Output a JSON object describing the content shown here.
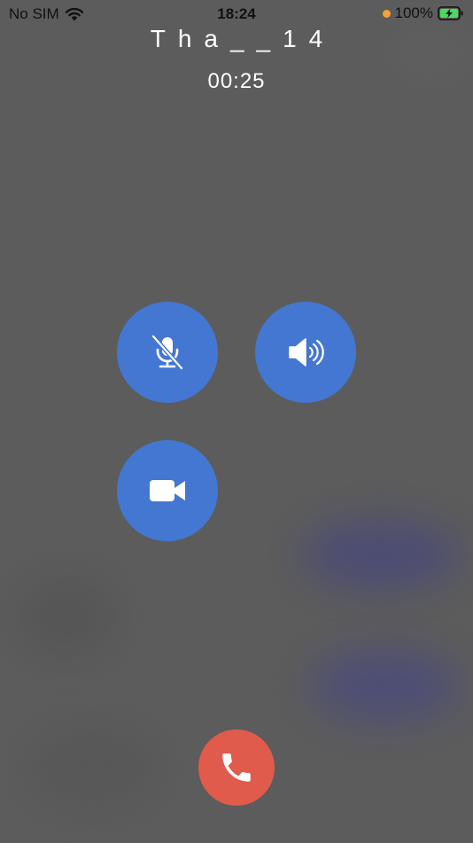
{
  "status_bar": {
    "carrier": "No SIM",
    "time": "18:24",
    "battery": "100%"
  },
  "call": {
    "caller_name": "Tha__14",
    "duration": "00:25"
  },
  "controls": {
    "mute": {
      "icon": "microphone-off-icon",
      "state": "muted"
    },
    "speaker": {
      "icon": "speaker-icon"
    },
    "video": {
      "icon": "video-camera-icon"
    },
    "end_call": {
      "icon": "phone-hangup-icon"
    }
  },
  "colors": {
    "background": "#5c5c5c",
    "control_button": "#4477d1",
    "end_call_button": "#e05b4b",
    "recording_dot": "#f7a13a",
    "battery_charging": "#4cd964"
  }
}
